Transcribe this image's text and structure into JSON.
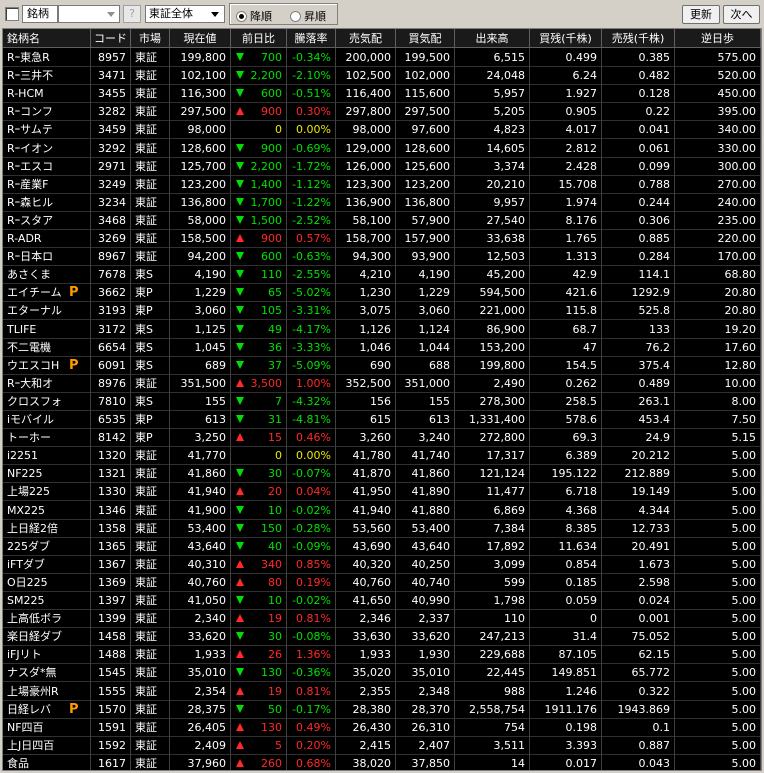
{
  "toolbar": {
    "label": "銘柄",
    "help": "?",
    "market": "東証全体",
    "desc": "降順",
    "asc": "昇順",
    "refresh": "更新",
    "next": "次へ"
  },
  "columns": [
    "銘柄名",
    "コード",
    "市場",
    "現在値",
    "前日比",
    "騰落率",
    "売気配",
    "買気配",
    "出来高",
    "買残(千株)",
    "売残(千株)",
    "逆日歩"
  ],
  "rows": [
    [
      "Rｰ東急R",
      "8957",
      "東証",
      "199,800",
      "dn",
      "700",
      "-0.34%",
      "200,000",
      "199,500",
      "6,515",
      "0.499",
      "0.385",
      "575.00",
      ""
    ],
    [
      "Rｰ三井不",
      "3471",
      "東証",
      "102,100",
      "dn",
      "2,200",
      "-2.10%",
      "102,500",
      "102,000",
      "24,048",
      "6.24",
      "0.482",
      "520.00",
      ""
    ],
    [
      "R-HCM",
      "3455",
      "東証",
      "116,300",
      "dn",
      "600",
      "-0.51%",
      "116,400",
      "115,600",
      "5,957",
      "1.927",
      "0.128",
      "450.00",
      ""
    ],
    [
      "Rｰコンフ",
      "3282",
      "東証",
      "297,500",
      "up",
      "900",
      "0.30%",
      "297,800",
      "297,500",
      "5,205",
      "0.905",
      "0.22",
      "395.00",
      ""
    ],
    [
      "Rｰサムテ",
      "3459",
      "東証",
      "98,000",
      "zero",
      "0",
      "0.00%",
      "98,000",
      "97,600",
      "4,823",
      "4.017",
      "0.041",
      "340.00",
      ""
    ],
    [
      "Rｰイオン",
      "3292",
      "東証",
      "128,600",
      "dn",
      "900",
      "-0.69%",
      "129,000",
      "128,600",
      "14,605",
      "2.812",
      "0.061",
      "330.00",
      ""
    ],
    [
      "Rｰエスコ",
      "2971",
      "東証",
      "125,700",
      "dn",
      "2,200",
      "-1.72%",
      "126,000",
      "125,600",
      "3,374",
      "2.428",
      "0.099",
      "300.00",
      ""
    ],
    [
      "Rｰ産業F",
      "3249",
      "東証",
      "123,200",
      "dn",
      "1,400",
      "-1.12%",
      "123,300",
      "123,200",
      "20,210",
      "15.708",
      "0.788",
      "270.00",
      ""
    ],
    [
      "Rｰ森ヒル",
      "3234",
      "東証",
      "136,800",
      "dn",
      "1,700",
      "-1.22%",
      "136,900",
      "136,800",
      "9,957",
      "1.974",
      "0.244",
      "240.00",
      ""
    ],
    [
      "Rｰスタア",
      "3468",
      "東証",
      "58,000",
      "dn",
      "1,500",
      "-2.52%",
      "58,100",
      "57,900",
      "27,540",
      "8.176",
      "0.306",
      "235.00",
      ""
    ],
    [
      "R-ADR",
      "3269",
      "東証",
      "158,500",
      "up",
      "900",
      "0.57%",
      "158,700",
      "157,900",
      "33,638",
      "1.765",
      "0.885",
      "220.00",
      ""
    ],
    [
      "Rｰ日本ロ",
      "8967",
      "東証",
      "94,200",
      "dn",
      "600",
      "-0.63%",
      "94,300",
      "93,900",
      "12,503",
      "1.313",
      "0.284",
      "170.00",
      ""
    ],
    [
      "あさくま",
      "7678",
      "東S",
      "4,190",
      "dn",
      "110",
      "-2.55%",
      "4,210",
      "4,190",
      "45,200",
      "42.9",
      "114.1",
      "68.80",
      ""
    ],
    [
      "エイチーム",
      "3662",
      "東P",
      "1,229",
      "dn",
      "65",
      "-5.02%",
      "1,230",
      "1,229",
      "594,500",
      "421.6",
      "1292.9",
      "20.80",
      "P"
    ],
    [
      "エターナル",
      "3193",
      "東P",
      "3,060",
      "dn",
      "105",
      "-3.31%",
      "3,075",
      "3,060",
      "221,000",
      "115.8",
      "525.8",
      "20.80",
      ""
    ],
    [
      "TLIFE",
      "3172",
      "東S",
      "1,125",
      "dn",
      "49",
      "-4.17%",
      "1,126",
      "1,124",
      "86,900",
      "68.7",
      "133",
      "19.20",
      ""
    ],
    [
      "不二電機",
      "6654",
      "東S",
      "1,045",
      "dn",
      "36",
      "-3.33%",
      "1,046",
      "1,044",
      "153,200",
      "47",
      "76.2",
      "17.60",
      ""
    ],
    [
      "ウエスコH",
      "6091",
      "東S",
      "689",
      "dn",
      "37",
      "-5.09%",
      "690",
      "688",
      "199,800",
      "154.5",
      "375.4",
      "12.80",
      "P"
    ],
    [
      "Rｰ大和オ",
      "8976",
      "東証",
      "351,500",
      "up",
      "3,500",
      "1.00%",
      "352,500",
      "351,000",
      "2,490",
      "0.262",
      "0.489",
      "10.00",
      ""
    ],
    [
      "クロスフォ",
      "7810",
      "東S",
      "155",
      "dn",
      "7",
      "-4.32%",
      "156",
      "155",
      "278,300",
      "258.5",
      "263.1",
      "8.00",
      ""
    ],
    [
      "iモバイル",
      "6535",
      "東P",
      "613",
      "dn",
      "31",
      "-4.81%",
      "615",
      "613",
      "1,331,400",
      "578.6",
      "453.4",
      "7.50",
      ""
    ],
    [
      "トーホー",
      "8142",
      "東P",
      "3,250",
      "up",
      "15",
      "0.46%",
      "3,260",
      "3,240",
      "272,800",
      "69.3",
      "24.9",
      "5.15",
      ""
    ],
    [
      "i2251",
      "1320",
      "東証",
      "41,770",
      "zero",
      "0",
      "0.00%",
      "41,780",
      "41,740",
      "17,317",
      "6.389",
      "20.212",
      "5.00",
      ""
    ],
    [
      "NF225",
      "1321",
      "東証",
      "41,860",
      "dn",
      "30",
      "-0.07%",
      "41,870",
      "41,860",
      "121,124",
      "195.122",
      "212.889",
      "5.00",
      ""
    ],
    [
      "上場225",
      "1330",
      "東証",
      "41,940",
      "up",
      "20",
      "0.04%",
      "41,950",
      "41,890",
      "11,477",
      "6.718",
      "19.149",
      "5.00",
      ""
    ],
    [
      "MX225",
      "1346",
      "東証",
      "41,900",
      "dn",
      "10",
      "-0.02%",
      "41,940",
      "41,880",
      "6,869",
      "4.368",
      "4.344",
      "5.00",
      ""
    ],
    [
      "上日経2倍",
      "1358",
      "東証",
      "53,400",
      "dn",
      "150",
      "-0.28%",
      "53,560",
      "53,400",
      "7,384",
      "8.385",
      "12.733",
      "5.00",
      ""
    ],
    [
      "225ダブ",
      "1365",
      "東証",
      "43,640",
      "dn",
      "40",
      "-0.09%",
      "43,690",
      "43,640",
      "17,892",
      "11.634",
      "20.491",
      "5.00",
      ""
    ],
    [
      "iFTダブ",
      "1367",
      "東証",
      "40,310",
      "up",
      "340",
      "0.85%",
      "40,320",
      "40,250",
      "3,099",
      "0.854",
      "1.673",
      "5.00",
      ""
    ],
    [
      "O日225",
      "1369",
      "東証",
      "40,760",
      "up",
      "80",
      "0.19%",
      "40,760",
      "40,740",
      "599",
      "0.185",
      "2.598",
      "5.00",
      ""
    ],
    [
      "SM225",
      "1397",
      "東証",
      "41,050",
      "dn",
      "10",
      "-0.02%",
      "41,650",
      "40,990",
      "1,798",
      "0.059",
      "0.024",
      "5.00",
      ""
    ],
    [
      "上高低ボラ",
      "1399",
      "東証",
      "2,340",
      "up",
      "19",
      "0.81%",
      "2,346",
      "2,337",
      "110",
      "0",
      "0.001",
      "5.00",
      ""
    ],
    [
      "楽日経ダブ",
      "1458",
      "東証",
      "33,620",
      "dn",
      "30",
      "-0.08%",
      "33,630",
      "33,620",
      "247,213",
      "31.4",
      "75.052",
      "5.00",
      ""
    ],
    [
      "iFJリト",
      "1488",
      "東証",
      "1,933",
      "up",
      "26",
      "1.36%",
      "1,933",
      "1,930",
      "229,688",
      "87.105",
      "62.15",
      "5.00",
      ""
    ],
    [
      "ナスダ*無",
      "1545",
      "東証",
      "35,010",
      "dn",
      "130",
      "-0.36%",
      "35,020",
      "35,010",
      "22,445",
      "149.851",
      "65.772",
      "5.00",
      ""
    ],
    [
      "上場豪州R",
      "1555",
      "東証",
      "2,354",
      "up",
      "19",
      "0.81%",
      "2,355",
      "2,348",
      "988",
      "1.246",
      "0.322",
      "5.00",
      ""
    ],
    [
      "日経レバ",
      "1570",
      "東証",
      "28,375",
      "dn",
      "50",
      "-0.17%",
      "28,380",
      "28,370",
      "2,558,754",
      "1911.176",
      "1943.869",
      "5.00",
      "P"
    ],
    [
      "NF四百",
      "1591",
      "東証",
      "26,405",
      "up",
      "130",
      "0.49%",
      "26,430",
      "26,310",
      "754",
      "0.198",
      "0.1",
      "5.00",
      ""
    ],
    [
      "上J日四百",
      "1592",
      "東証",
      "2,409",
      "up",
      "5",
      "0.20%",
      "2,415",
      "2,407",
      "3,511",
      "3.393",
      "0.887",
      "5.00",
      ""
    ],
    [
      "食品",
      "1617",
      "東証",
      "37,960",
      "up",
      "260",
      "0.68%",
      "38,020",
      "37,850",
      "14",
      "0.017",
      "0.043",
      "5.00",
      ""
    ]
  ]
}
